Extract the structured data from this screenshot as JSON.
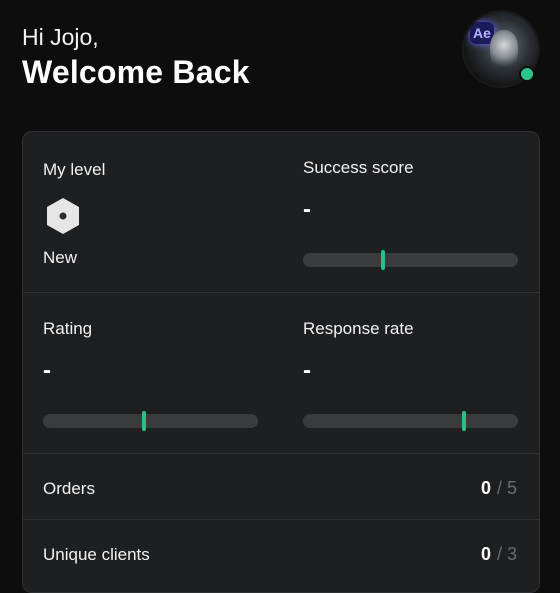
{
  "header": {
    "greeting": "Hi Jojo,",
    "title": "Welcome Back"
  },
  "avatar": {
    "badge_text": "Ae",
    "status": "online",
    "status_color": "#2bc48a"
  },
  "metrics": {
    "level": {
      "label": "My level",
      "value": "New",
      "icon": "hexagon-level-icon"
    },
    "success_score": {
      "label": "Success score",
      "value": "-",
      "indicator_fraction": 0.37
    },
    "rating": {
      "label": "Rating",
      "value": "-",
      "indicator_fraction": 0.47
    },
    "response_rate": {
      "label": "Response rate",
      "value": "-",
      "indicator_fraction": 0.75
    }
  },
  "counts": {
    "orders": {
      "label": "Orders",
      "value": "0",
      "total": "/ 5"
    },
    "unique_clients": {
      "label": "Unique clients",
      "value": "0",
      "total": "/ 3"
    }
  },
  "colors": {
    "accent": "#27c182",
    "background": "#0d0d0d",
    "card": "#1e1f21"
  }
}
